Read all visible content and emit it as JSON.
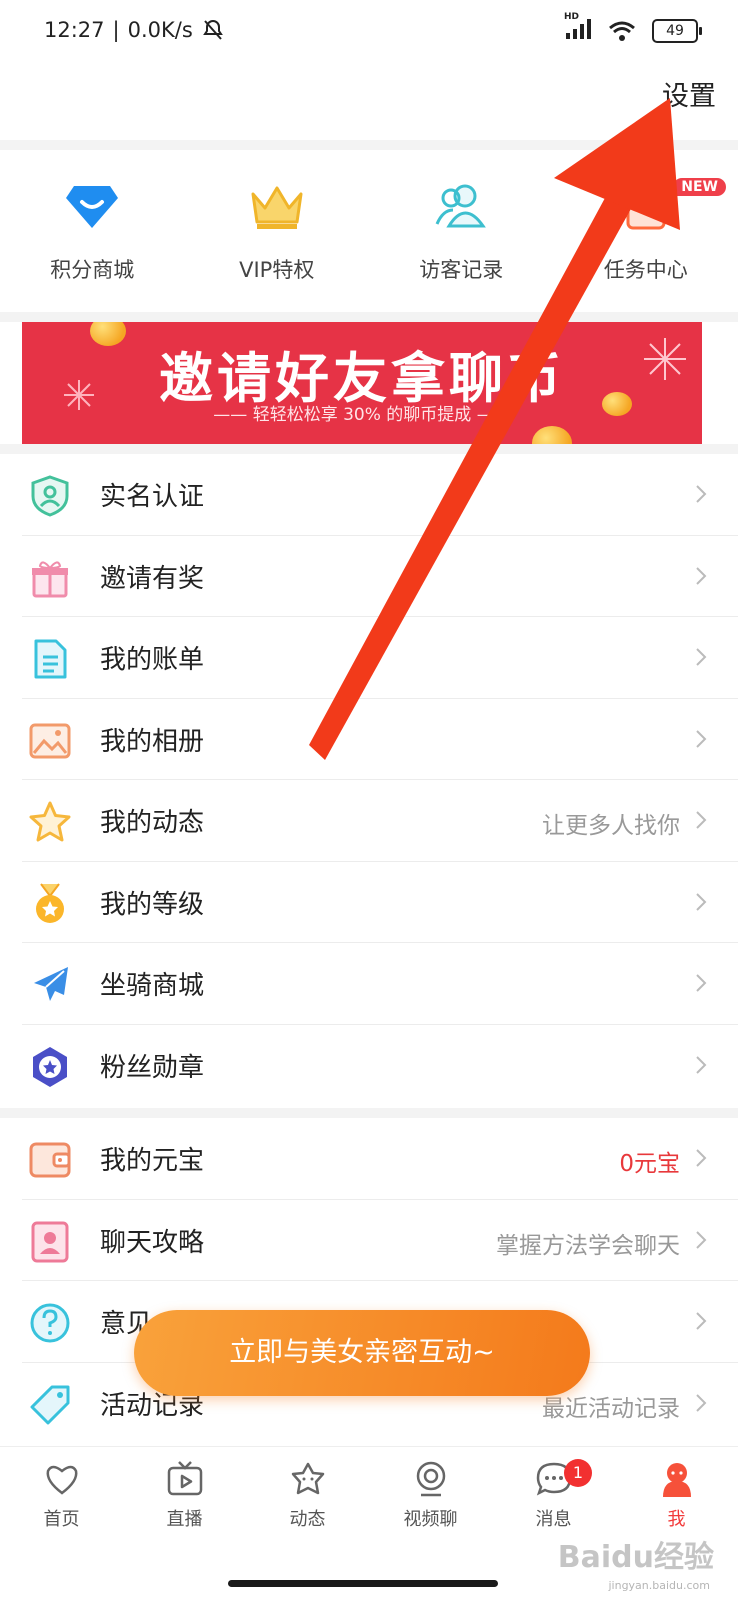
{
  "status_bar": {
    "time": "12:27",
    "speed": "0.0K/s",
    "network_type": "HD",
    "battery": "49"
  },
  "header": {
    "settings_label": "设置"
  },
  "quick_actions": [
    {
      "label": "积分商城",
      "icon": "diamond-icon",
      "color": "#1f8df0"
    },
    {
      "label": "VIP特权",
      "icon": "crown-icon",
      "color": "#f5c543"
    },
    {
      "label": "访客记录",
      "icon": "users-icon",
      "color": "#3dbfcf"
    },
    {
      "label": "任务中心",
      "icon": "task-icon",
      "color": "#ff6a3c",
      "badge": "NEW"
    }
  ],
  "banner": {
    "title": "邀请好友拿聊币",
    "subtitle": "—— 轻轻松松享 30% 的聊币提成 ——"
  },
  "menu_group_1": [
    {
      "label": "实名认证",
      "icon": "shield-user-icon",
      "value": ""
    },
    {
      "label": "邀请有奖",
      "icon": "gift-icon",
      "value": ""
    },
    {
      "label": "我的账单",
      "icon": "document-icon",
      "value": ""
    },
    {
      "label": "我的相册",
      "icon": "photo-album-icon",
      "value": ""
    },
    {
      "label": "我的动态",
      "icon": "star-icon",
      "value": "让更多人找你"
    },
    {
      "label": "我的等级",
      "icon": "medal-icon",
      "value": ""
    },
    {
      "label": "坐骑商城",
      "icon": "airplane-icon",
      "value": ""
    },
    {
      "label": "粉丝勋章",
      "icon": "badge-star-icon",
      "value": ""
    }
  ],
  "menu_group_2": [
    {
      "label": "我的元宝",
      "icon": "wallet-icon",
      "value": "0元宝",
      "value_color": "#e8383b"
    },
    {
      "label": "聊天攻略",
      "icon": "chat-guide-icon",
      "value": "掌握方法学会聊天"
    },
    {
      "label": "意见",
      "icon": "help-icon",
      "value": ""
    },
    {
      "label": "活动记录",
      "icon": "tag-icon",
      "value": "最近活动记录"
    }
  ],
  "floating_cta": {
    "label": "立即与美女亲密互动~"
  },
  "tab_bar": [
    {
      "label": "首页",
      "icon": "home-heart-icon"
    },
    {
      "label": "直播",
      "icon": "tv-icon"
    },
    {
      "label": "动态",
      "icon": "moments-icon"
    },
    {
      "label": "视频聊",
      "icon": "camera-icon"
    },
    {
      "label": "消息",
      "icon": "message-icon",
      "badge": "1"
    },
    {
      "label": "我",
      "icon": "profile-icon",
      "active": true
    }
  ],
  "watermark": {
    "text": "Baidu经验",
    "sub": "jingyan.baidu.com"
  }
}
